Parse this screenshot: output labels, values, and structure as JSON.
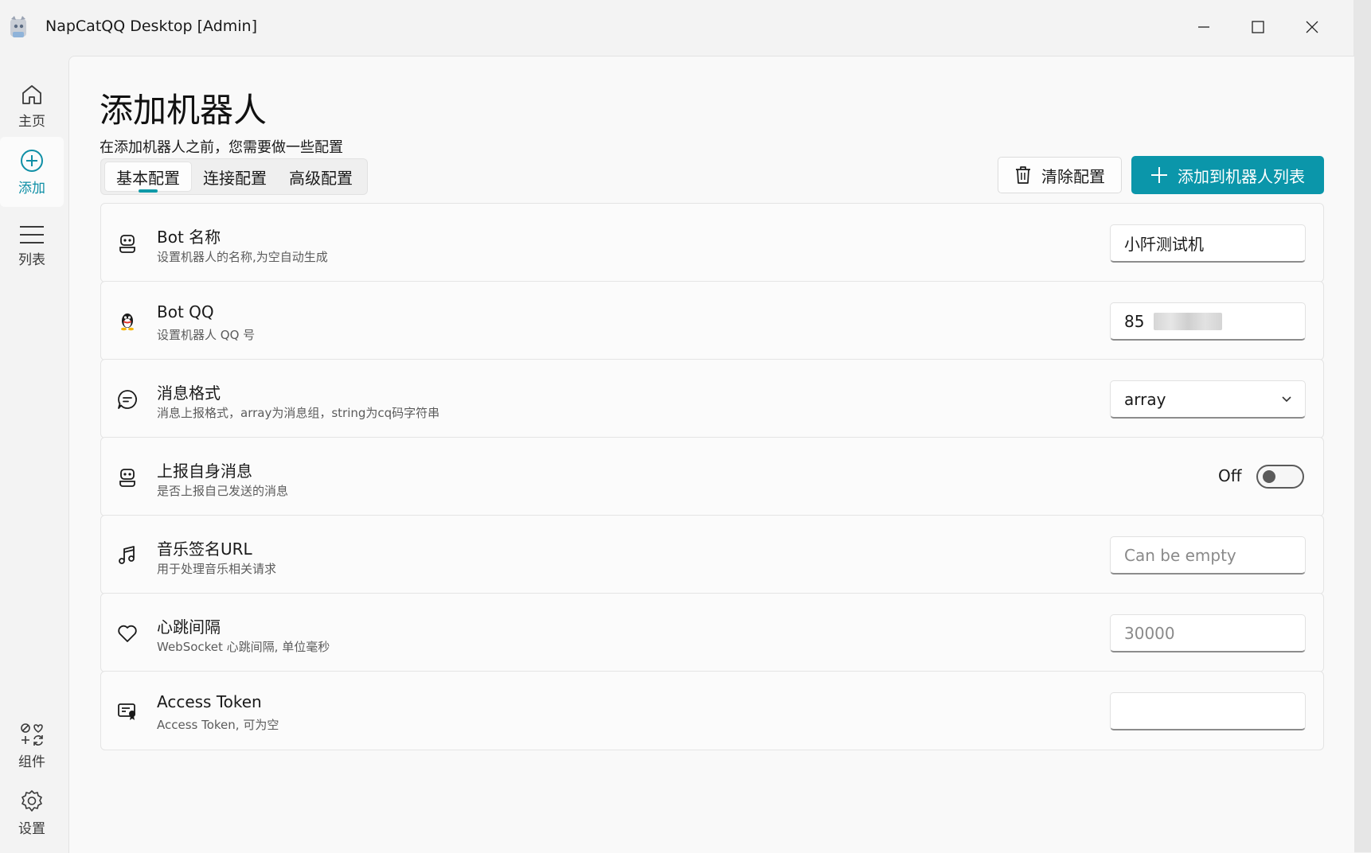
{
  "window": {
    "title": "NapCatQQ Desktop [Admin]"
  },
  "nav": {
    "items": [
      {
        "label": "主页",
        "icon": "home-icon"
      },
      {
        "label": "添加",
        "icon": "add-circle-icon",
        "active": true
      },
      {
        "label": "列表",
        "icon": "list-icon"
      },
      {
        "label": "组件",
        "icon": "components-icon"
      },
      {
        "label": "设置",
        "icon": "settings-icon"
      }
    ]
  },
  "page": {
    "title": "添加机器人",
    "subtitle": "在添加机器人之前，您需要做一些配置",
    "tabs": [
      {
        "label": "基本配置",
        "active": true
      },
      {
        "label": "连接配置"
      },
      {
        "label": "高级配置"
      }
    ],
    "clear_label": "清除配置",
    "add_label": "添加到机器人列表"
  },
  "settings": {
    "bot_name": {
      "title": "Bot 名称",
      "desc": "设置机器人的名称,为空自动生成",
      "value": "小阡测试机"
    },
    "bot_qq": {
      "title": "Bot QQ",
      "desc": "设置机器人 QQ 号",
      "value": "85"
    },
    "msg_format": {
      "title": "消息格式",
      "desc": "消息上报格式，array为消息组，string为cq码字符串",
      "value": "array"
    },
    "report_self": {
      "title": "上报自身消息",
      "desc": "是否上报自己发送的消息",
      "state": "Off"
    },
    "music_url": {
      "title": "音乐签名URL",
      "desc": "用于处理音乐相关请求",
      "placeholder": "Can be empty"
    },
    "heartbeat": {
      "title": "心跳间隔",
      "desc": "WebSocket 心跳间隔, 单位毫秒",
      "placeholder": "30000"
    },
    "access_token": {
      "title": "Access Token",
      "desc": "Access Token, 可为空",
      "value": ""
    }
  },
  "colors": {
    "accent": "#0b96aa"
  }
}
